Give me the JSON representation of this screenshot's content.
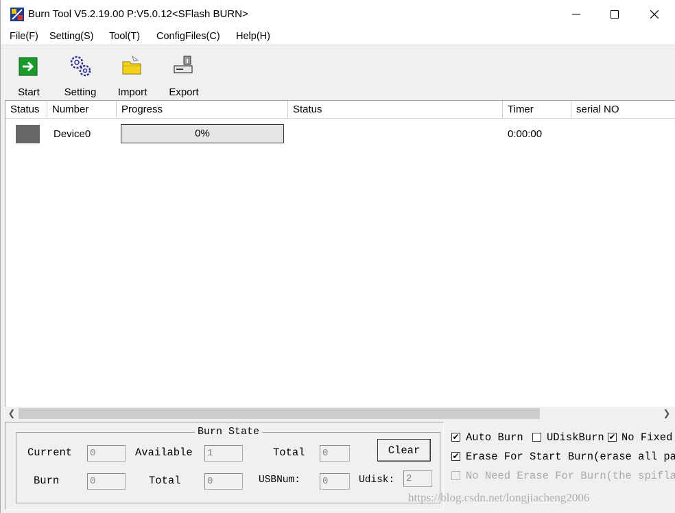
{
  "window": {
    "title": "Burn Tool V5.2.19.00 P:V5.0.12<SFlash BURN>"
  },
  "menu": [
    "File(F)",
    "Setting(S)",
    "Tool(T)",
    "ConfigFiles(C)",
    "Help(H)"
  ],
  "toolbar": {
    "start": "Start",
    "setting": "Setting",
    "import": "Import",
    "export": "Export"
  },
  "columns": [
    "Status",
    "Number",
    "Progress",
    "Status",
    "Timer",
    "serial NO"
  ],
  "devices": [
    {
      "name": "Device0",
      "progress_percent": 0,
      "progress_label": "0%",
      "timer": "0:00:00",
      "status_color": "#666666"
    }
  ],
  "burn_state": {
    "title": "Burn State",
    "current_label": "Current",
    "current_value": "0",
    "available_label": "Available",
    "available_value": "1",
    "total_label": "Total",
    "total_value": "0",
    "clear_label": "Clear",
    "burn_label": "Burn",
    "burn_value": "0",
    "total2_label": "Total",
    "total2_value": "0",
    "usbnum_label": "USBNum:",
    "usbnum_value": "0",
    "udisk_label": "Udisk:",
    "udisk_value": "2"
  },
  "options": {
    "auto_burn": {
      "label": "Auto Burn",
      "checked": true
    },
    "udisk_burn": {
      "label": "UDiskBurn",
      "checked": false
    },
    "no_fixed": {
      "label": "No Fixed",
      "checked": true
    },
    "erase_for_start": {
      "label": "Erase For Start Burn(erase all part",
      "checked": true
    },
    "no_need_erase": {
      "label": "No Need Erase For Burn(the spiflash",
      "checked": false,
      "disabled": true
    }
  },
  "check_mark": "✔",
  "watermark": "https://blog.csdn.net/longjiacheng2006",
  "colors": {
    "start_icon": "#1a9a2a",
    "setting_icon": "#2d2d8f",
    "import_icon": "#f2d21b"
  }
}
